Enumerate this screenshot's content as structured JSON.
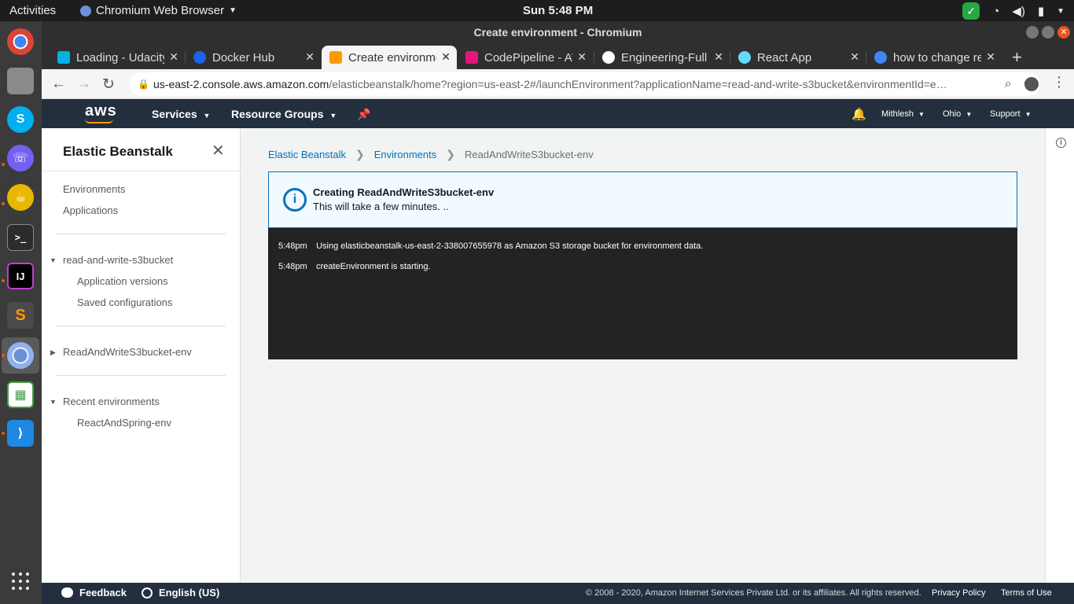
{
  "os": {
    "activities": "Activities",
    "app_name": "Chromium Web Browser",
    "clock": "Sun  5:48 PM"
  },
  "window": {
    "title": "Create environment - Chromium"
  },
  "tabs": [
    {
      "label": "Loading - Udacity",
      "color": "#02b3e4"
    },
    {
      "label": "Docker Hub",
      "color": "#1d63ed"
    },
    {
      "label": "Create environment",
      "color": "#ff9900"
    },
    {
      "label": "CodePipeline - AWS",
      "color": "#e7157b"
    },
    {
      "label": "Engineering-Full",
      "color": "#ffffff"
    },
    {
      "label": "React App",
      "color": "#61dafb"
    },
    {
      "label": "how to change react",
      "color": "#4285f4"
    }
  ],
  "omnibox": {
    "host": "us-east-2.console.aws.amazon.com",
    "path": "/elasticbeanstalk/home?region=us-east-2#/launchEnvironment?applicationName=read-and-write-s3bucket&environmentId=e…"
  },
  "aws_header": {
    "logo": "aws",
    "services": "Services",
    "resource_groups": "Resource Groups",
    "user": "Mithlesh",
    "region": "Ohio",
    "support": "Support"
  },
  "sidebar": {
    "title": "Elastic Beanstalk",
    "environments": "Environments",
    "applications": "Applications",
    "app_name": "read-and-write-s3bucket",
    "app_versions": "Application versions",
    "saved_configs": "Saved configurations",
    "env_name": "ReadAndWriteS3bucket-env",
    "recent_envs": "Recent environments",
    "recent_env_1": "ReactAndSpring-env"
  },
  "breadcrumb": {
    "root": "Elastic Beanstalk",
    "level2": "Environments",
    "current": "ReadAndWriteS3bucket-env"
  },
  "flash": {
    "title": "Creating ReadAndWriteS3bucket-env",
    "message": "This will take a few minutes. .."
  },
  "events": [
    {
      "time": "5:48pm",
      "message": "Using elasticbeanstalk-us-east-2-338007655978 as Amazon S3 storage bucket for environment data."
    },
    {
      "time": "5:48pm",
      "message": "createEnvironment is starting."
    }
  ],
  "footer": {
    "feedback": "Feedback",
    "language": "English (US)",
    "copyright": "© 2008 - 2020, Amazon Internet Services Private Ltd. or its affiliates. All rights reserved.",
    "privacy": "Privacy Policy",
    "terms": "Terms of Use"
  }
}
